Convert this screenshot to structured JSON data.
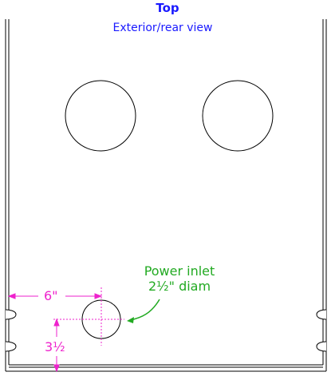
{
  "diagram": {
    "title": "Top",
    "view_label": "Exterior/rear view",
    "callout": {
      "line1": "Power inlet",
      "line2": "2½\" diam"
    },
    "dimensions": {
      "horizontal": "6\"",
      "vertical": "3½"
    },
    "colors": {
      "title": "#1a1aff",
      "callout": "#22aa22",
      "dimension": "#ee22cc",
      "outline": "#000000"
    }
  }
}
